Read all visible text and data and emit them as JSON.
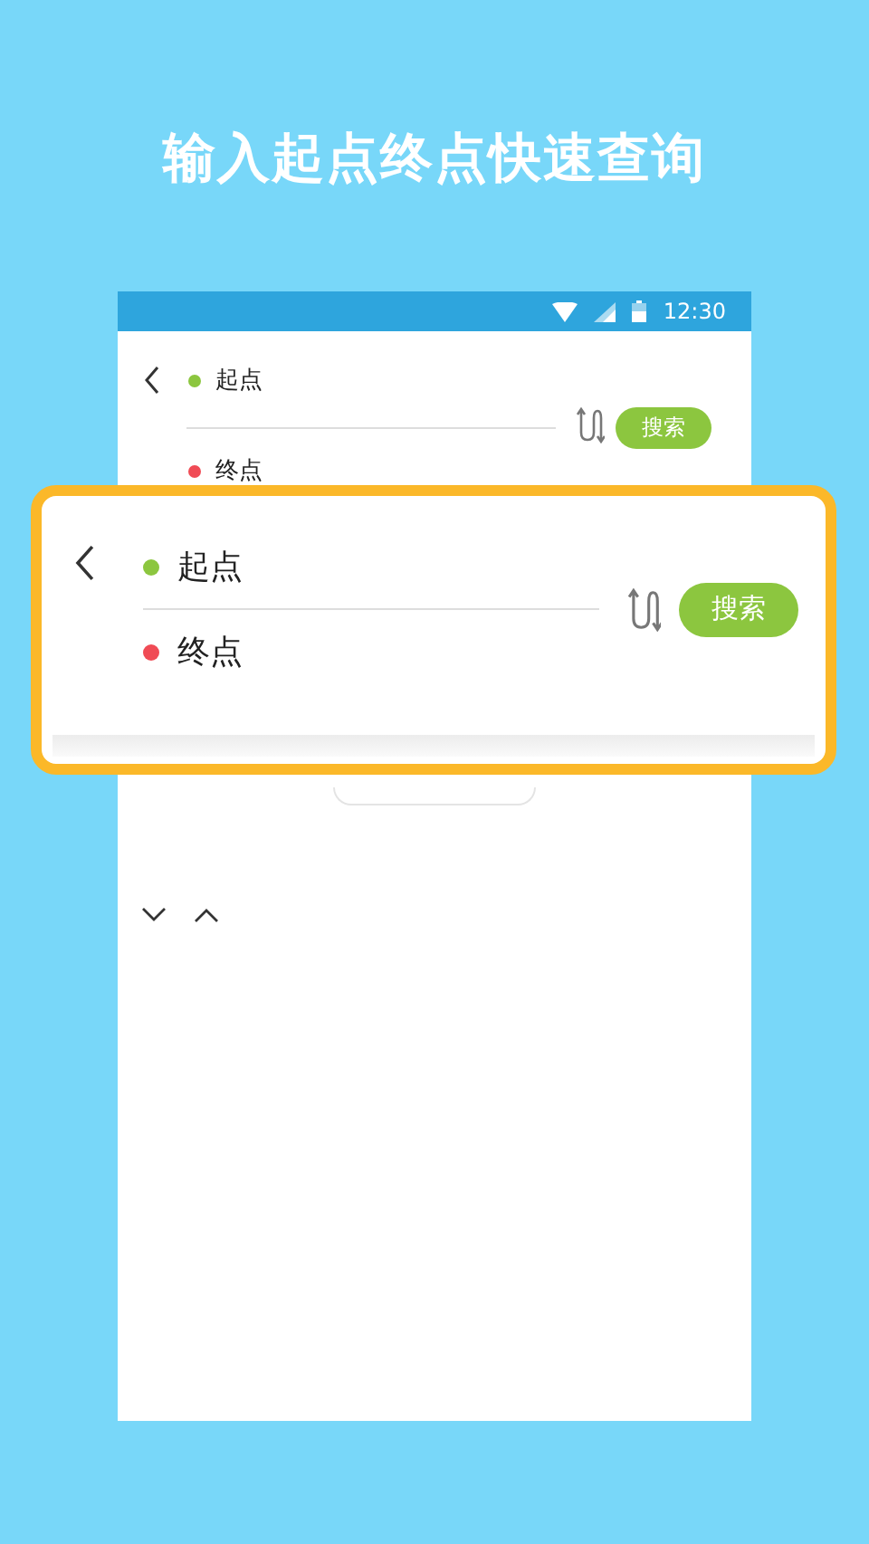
{
  "headline": "输入起点终点快速查询",
  "status_bar": {
    "time": "12:30"
  },
  "route_form": {
    "points": [
      {
        "label": "起点",
        "color": "#8cc63f"
      },
      {
        "label": "终点",
        "color": "#f04b55"
      }
    ],
    "search_button": "搜索"
  },
  "callout": {
    "points": [
      {
        "label": "起点",
        "color": "#8cc63f"
      },
      {
        "label": "终点",
        "color": "#f04b55"
      }
    ],
    "search_button": "搜索"
  }
}
